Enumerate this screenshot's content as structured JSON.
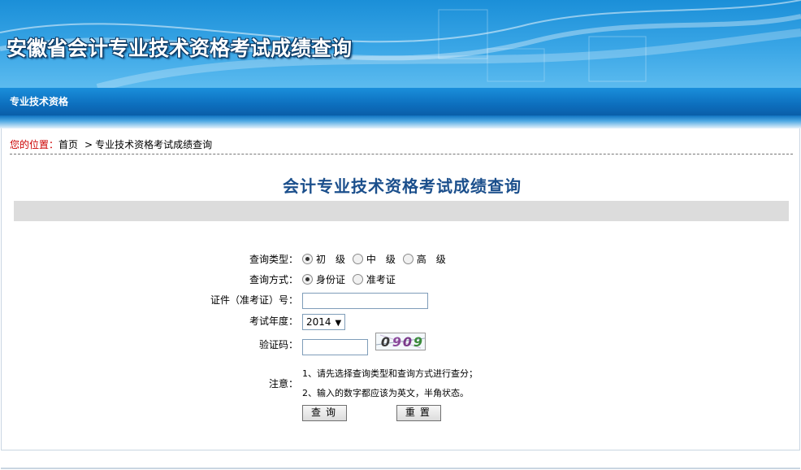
{
  "header": {
    "site_title": "安徽省会计专业技术资格考试成绩查询"
  },
  "nav": {
    "item": "专业技术资格"
  },
  "breadcrumb": {
    "label": "您的位置：",
    "home": "首页",
    "separator": ">",
    "current": "专业技术资格考试成绩查询"
  },
  "page": {
    "heading": "会计专业技术资格考试成绩查询"
  },
  "form": {
    "query_type": {
      "label": "查询类型：",
      "options": [
        "初　级",
        "中　级",
        "高　级"
      ],
      "selected": "初　级"
    },
    "query_method": {
      "label": "查询方式：",
      "options": [
        "身份证",
        "准考证"
      ],
      "selected": "身份证"
    },
    "id_number": {
      "label": "证件（准考证）号：",
      "value": ""
    },
    "exam_year": {
      "label": "考试年度：",
      "value": "2014"
    },
    "captcha": {
      "label": "验证码：",
      "value": "",
      "image_text": "0909"
    },
    "notes": {
      "label": "注意：",
      "lines": [
        "1、请先选择查询类型和查询方式进行查分；",
        "2、输入的数字都应该为英文，半角状态。"
      ]
    },
    "buttons": {
      "query": "查询",
      "reset": "重置"
    }
  },
  "colors": {
    "banner": "#1b8fd8",
    "nav": "#0d6fbe",
    "heading": "#1b4f8c",
    "breadcrumb_label": "#cc0000"
  },
  "icons": {
    "radio_selected": "radio-selected-icon",
    "select_arrow": "chevron-down-icon"
  }
}
